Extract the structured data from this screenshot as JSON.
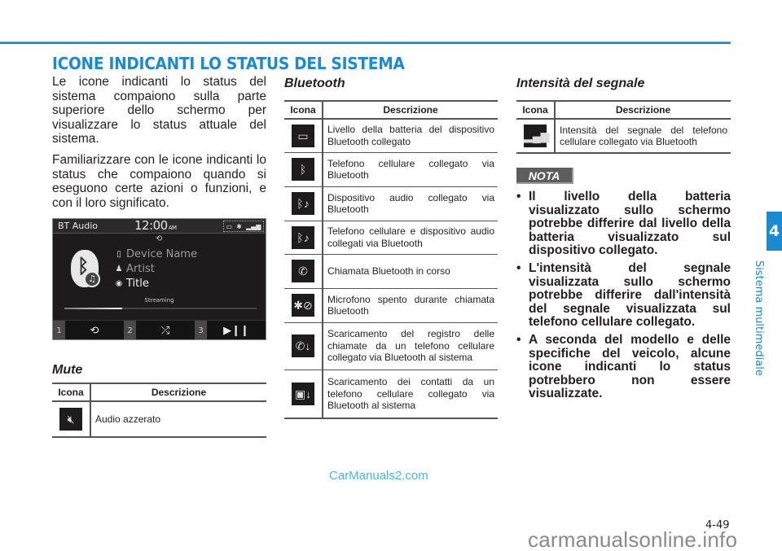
{
  "page": {
    "title": "ICONE INDICANTI LO STATUS DEL SISTEMA",
    "page_number": "4-49",
    "chapter_number": "4",
    "chapter_label": "Sistema multimediale",
    "accent_color": "#1a8ad2"
  },
  "intro": {
    "paragraphs": [
      "Le icone indicanti lo status del sistema compaiono sulla parte superiore dello schermo per visualizzare lo status attuale del sistema.",
      "Familiarizzare con le icone indicanti lo status che compaiono quando si eseguono certe azioni o funzioni, e con il loro significato."
    ]
  },
  "screen": {
    "title": "BT Audio",
    "time": "12:00",
    "ampm": "AM",
    "status_icons": [
      "battery-icon",
      "bluetooth-phone-icon",
      "signal-icon"
    ],
    "device_name": "Device Name",
    "artist": "Artist",
    "track_title": "Title",
    "streaming_label": "Streaming",
    "progress": 0.3,
    "presets": [
      "1",
      "2",
      "3"
    ],
    "controls": [
      "repeat",
      "shuffle",
      "play-pause"
    ]
  },
  "mute": {
    "heading": "Mute",
    "col_icon": "Icona",
    "col_desc": "Descrizione",
    "rows": [
      {
        "icon": "mute-icon",
        "desc": "Audio azzerato"
      }
    ]
  },
  "bluetooth": {
    "heading": "Bluetooth",
    "col_icon": "Icona",
    "col_desc": "Descrizione",
    "rows": [
      {
        "icon": "bt-battery-icon",
        "desc": "Livello della batteria del dispositivo Bluetooth collegato"
      },
      {
        "icon": "bt-phone-icon",
        "desc": "Telefono cellulare collegato via Bluetooth"
      },
      {
        "icon": "bt-audio-icon",
        "desc": "Dispositivo audio collegato via Bluetooth"
      },
      {
        "icon": "bt-phone-audio-icon",
        "desc": "Telefono cellulare e dispositivo audio collegati via Bluetooth"
      },
      {
        "icon": "bt-call-icon",
        "desc": "Chiamata Bluetooth in corso"
      },
      {
        "icon": "bt-mic-mute-icon",
        "desc": "Microfono spento durante chiamata Bluetooth"
      },
      {
        "icon": "call-log-download-icon",
        "desc": "Scaricamento del registro delle chiamate da un telefono cellulare collegato via Bluetooth al sistema"
      },
      {
        "icon": "contacts-download-icon",
        "desc": "Scaricamento dei contatti da un telefono cellulare collegato via Bluetooth al sistema"
      }
    ]
  },
  "signal": {
    "heading": "Intensità del segnale",
    "col_icon": "Icona",
    "col_desc": "Descrizione",
    "rows": [
      {
        "icon": "signal-strength-icon",
        "desc": "Intensità del segnale del telefono cellulare collegato via Bluetooth"
      }
    ]
  },
  "nota": {
    "label": "NOTA",
    "items": [
      "Il livello della batteria visualizzato sullo schermo potrebbe differire dal livello della batteria visualizzato sul dispositivo collegato.",
      "L'intensità del segnale visualizzata sullo schermo potrebbe differire dall'intensità del segnale visualizzata sul telefono cellulare collegato.",
      "A seconda del modello e delle specifiche del veicolo, alcune icone indicanti lo status potrebbero non essere visualizzate."
    ]
  },
  "watermarks": {
    "site1": "CarManuals2.com",
    "site2": "carmanualsonline.info"
  }
}
